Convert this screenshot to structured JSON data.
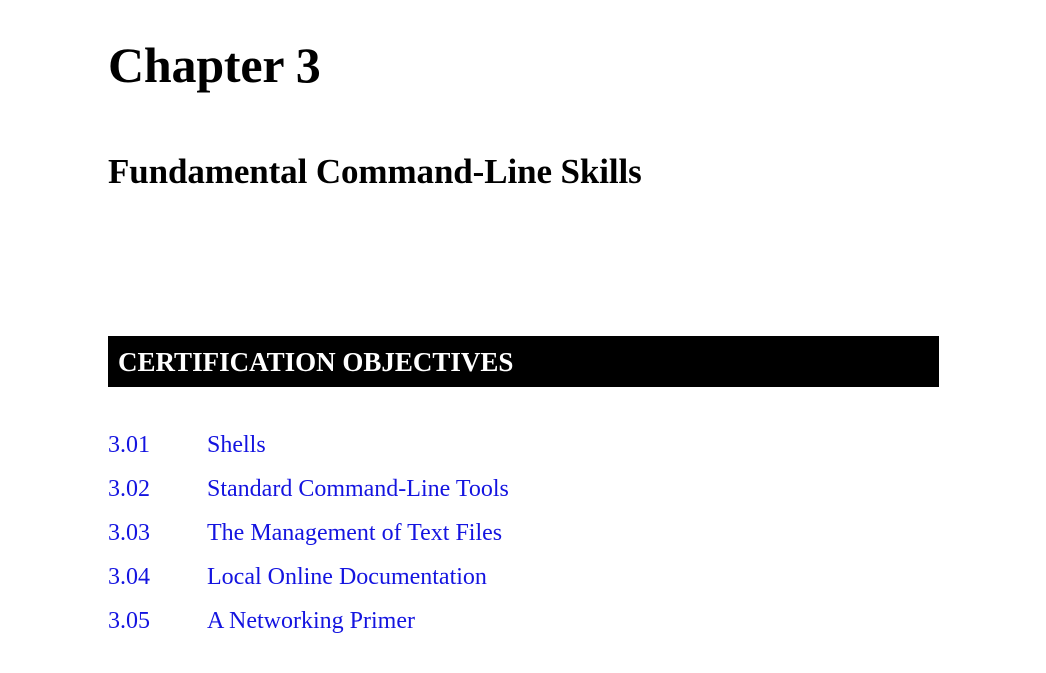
{
  "page": {
    "background_color": "#ffffff",
    "text_color": "#000000",
    "accent_color": "#1414e0",
    "banner_color": "#000000"
  },
  "chapter": {
    "title": "Chapter 3",
    "subtitle": "Fundamental Command-Line Skills"
  },
  "objectives_banner": {
    "label": "CERTIFICATION OBJECTIVES"
  },
  "objectives": [
    {
      "number": "3.01",
      "label": "Shells"
    },
    {
      "number": "3.02",
      "label": "Standard Command-Line Tools"
    },
    {
      "number": "3.03",
      "label": "The Management of Text Files"
    },
    {
      "number": "3.04",
      "label": "Local Online Documentation"
    },
    {
      "number": "3.05",
      "label": "A Networking Primer"
    }
  ]
}
